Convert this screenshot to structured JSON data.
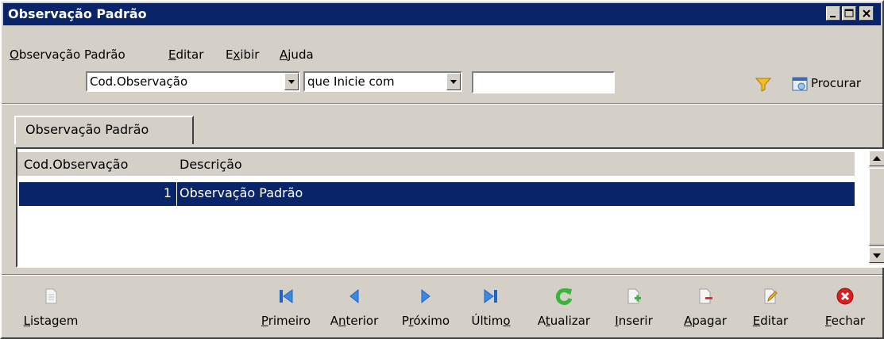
{
  "window": {
    "title": "Observação Padrão"
  },
  "menubar": {
    "items": [
      {
        "label_pre": "",
        "label_u": "O",
        "label_post": "bservação Padrão"
      },
      {
        "label_pre": "",
        "label_u": "E",
        "label_post": "ditar"
      },
      {
        "label_pre": "E",
        "label_u": "x",
        "label_post": "ibir"
      },
      {
        "label_pre": "",
        "label_u": "A",
        "label_post": "juda"
      }
    ]
  },
  "search": {
    "field_value": "Cod.Observação",
    "condition_value": "que Inicie com",
    "text_value": "",
    "procurar_label": "Procurar"
  },
  "tab": {
    "label": "Observação Padrão"
  },
  "grid": {
    "columns": [
      "Cod.Observação",
      "Descrição"
    ],
    "rows": [
      {
        "cod": "1",
        "descricao": "Observação Padrão"
      }
    ]
  },
  "toolbar": {
    "listagem": {
      "pre": "",
      "u": "L",
      "post": "istagem"
    },
    "primeiro": {
      "pre": "",
      "u": "P",
      "post": "rimeiro"
    },
    "anterior": {
      "pre": "A",
      "u": "n",
      "post": "terior"
    },
    "proximo": {
      "pre": "P",
      "u": "r",
      "post": "óximo"
    },
    "ultimo": {
      "pre": "Últim",
      "u": "o",
      "post": ""
    },
    "atualizar": {
      "pre": "A",
      "u": "t",
      "post": "ualizar"
    },
    "inserir": {
      "pre": "",
      "u": "I",
      "post": "nserir"
    },
    "apagar": {
      "pre": "",
      "u": "A",
      "post": "pagar"
    },
    "editar": {
      "pre": "",
      "u": "E",
      "post": "ditar"
    },
    "fechar": {
      "pre": "",
      "u": "F",
      "post": "echar"
    }
  },
  "colors": {
    "titlebar": "#0a246a",
    "face": "#d4d0c8",
    "selection": "#0a246a"
  }
}
